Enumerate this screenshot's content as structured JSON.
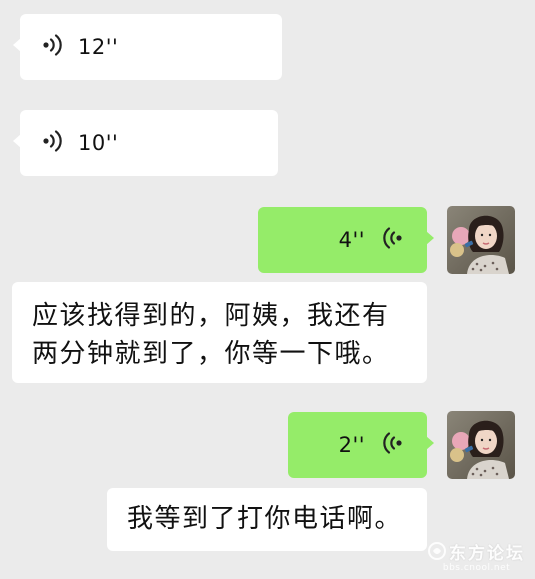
{
  "messages": [
    {
      "side": "left",
      "type": "voice",
      "duration": "12''"
    },
    {
      "side": "left",
      "type": "voice",
      "duration": "10''"
    },
    {
      "side": "right",
      "type": "voice",
      "duration": "4''"
    },
    {
      "side": "left",
      "type": "text",
      "lines": [
        "应该找得到的，阿姨，我还有",
        "两分钟就到了，你等一下哦。"
      ]
    },
    {
      "side": "right",
      "type": "voice",
      "duration": "2''"
    },
    {
      "side": "left",
      "type": "text",
      "lines": [
        "我等到了打你电话啊。"
      ]
    }
  ],
  "watermark": {
    "main": "东方论坛",
    "sub": "bbs.cnool.net"
  },
  "colors": {
    "background": "#ebebeb",
    "incoming_bubble": "#ffffff",
    "outgoing_bubble": "#95ec69"
  },
  "icons": {
    "voice_in": "voice-wave-left-icon",
    "voice_out": "voice-wave-right-icon"
  }
}
